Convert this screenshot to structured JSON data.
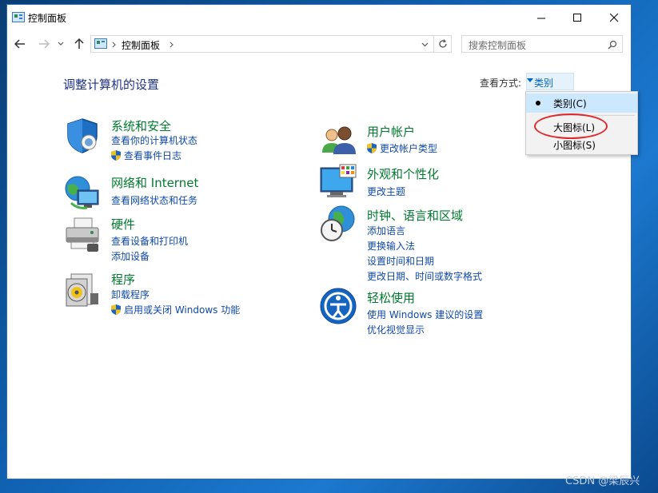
{
  "window": {
    "title": "控制面板"
  },
  "nav": {
    "breadcrumb": "控制面板",
    "search_placeholder": "搜索控制面板"
  },
  "main": {
    "heading": "调整计算机的设置",
    "view_by_label": "查看方式:",
    "view_by_value": "类别"
  },
  "view_menu": {
    "options": [
      "类别(C)",
      "大图标(L)",
      "小图标(S)"
    ],
    "selected": "类别(C)",
    "highlighted_option": "大图标(L)"
  },
  "categories_left": [
    {
      "title": "系统和安全",
      "icon": "shield-icon",
      "links": [
        "查看你的计算机状态",
        "查看事件日志"
      ]
    },
    {
      "title": "网络和 Internet",
      "icon": "network-globe-icon",
      "links": [
        "查看网络状态和任务"
      ]
    },
    {
      "title": "硬件",
      "icon": "printer-icon",
      "links": [
        "查看设备和打印机",
        "添加设备"
      ]
    },
    {
      "title": "程序",
      "icon": "programs-disk-icon",
      "links": [
        "卸载程序",
        "启用或关闭 Windows 功能"
      ]
    }
  ],
  "categories_right": [
    {
      "title": "用户帐户",
      "icon": "users-icon",
      "links": [
        "更改帐户类型"
      ]
    },
    {
      "title": "外观和个性化",
      "icon": "monitor-palette-icon",
      "links": [
        "更改主题"
      ]
    },
    {
      "title": "时钟、语言和区域",
      "icon": "clock-globe-icon",
      "links": [
        "添加语言",
        "更换输入法",
        "设置时间和日期",
        "更改日期、时间或数字格式"
      ]
    },
    {
      "title": "轻松使用",
      "icon": "ease-of-access-icon",
      "links": [
        "使用 Windows 建议的设置",
        "优化视觉显示"
      ]
    }
  ],
  "watermark": "CSDN @梁辰兴",
  "colors": {
    "category_title": "#007a2e",
    "link": "#0f4aa8",
    "heading": "#1e3287",
    "highlight_circle": "#e0282c"
  }
}
